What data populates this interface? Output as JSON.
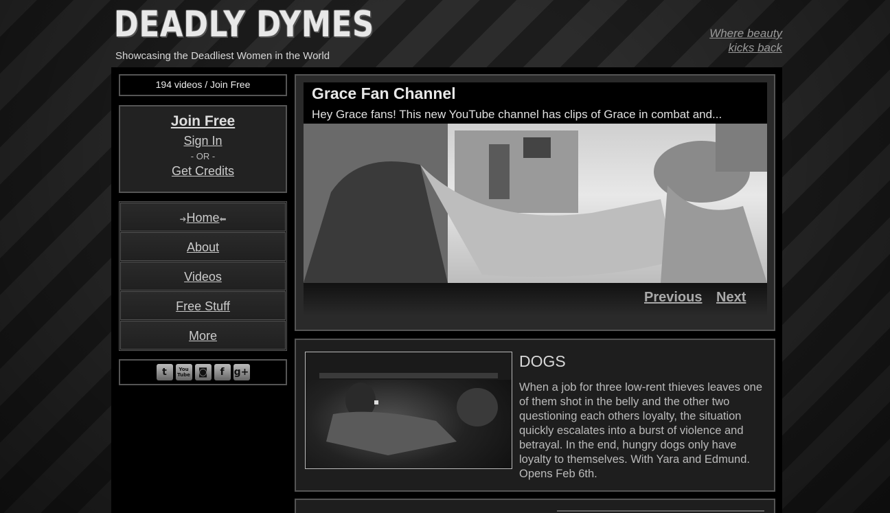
{
  "header": {
    "logo": "DEADLY DYMES",
    "tagline": "Showcasing the Deadliest Women in the World",
    "slogan_line1": "Where beauty",
    "slogan_line2": "kicks back"
  },
  "sidebar": {
    "videos_count": "194 videos / Join Free",
    "join_free": "Join Free",
    "sign_in": "Sign In",
    "or": "- OR -",
    "get_credits": "Get Credits",
    "nav": [
      {
        "label": "Home"
      },
      {
        "label": "About"
      },
      {
        "label": "Videos"
      },
      {
        "label": "Free Stuff"
      },
      {
        "label": "More"
      }
    ],
    "social": [
      "twitter-icon",
      "youtube-icon",
      "instagram-icon",
      "facebook-icon",
      "google-plus-icon"
    ]
  },
  "feature": {
    "title": "Grace Fan Channel",
    "description": "Hey Grace fans! This new YouTube channel has clips of Grace in combat and...",
    "prev": "Previous",
    "next": "Next"
  },
  "article": {
    "title": "DOGS",
    "text": "When a job for three low-rent thieves leaves one of them shot in the belly and the other two questioning each others loyalty, the situation quickly escalates into a burst of violence and betrayal. In the end, hungry dogs only have loyalty to themselves. With Yara and Edmund. Opens Feb 6th."
  }
}
